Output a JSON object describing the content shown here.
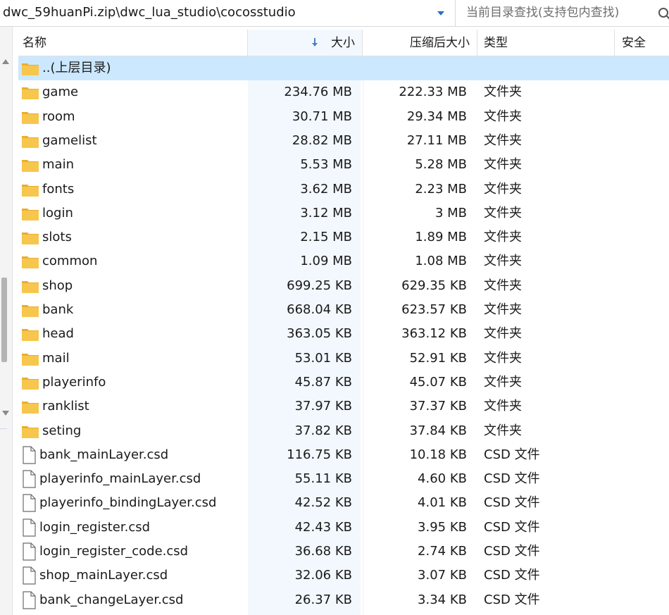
{
  "address": {
    "path": "dwc_59huanPi.zip\\dwc_lua_studio\\cocosstudio",
    "search_placeholder": "当前目录查找(支持包内查找)"
  },
  "columns": {
    "name": "名称",
    "size": "大小",
    "compressed": "压缩后大小",
    "type": "类型",
    "security": "安全"
  },
  "rows": [
    {
      "icon": "folder-icon",
      "name": "..(上层目录)",
      "size": "",
      "compressed": "",
      "type": "",
      "selected": true
    },
    {
      "icon": "folder-icon",
      "name": "game",
      "size": "234.76 MB",
      "compressed": "222.33 MB",
      "type": "文件夹"
    },
    {
      "icon": "folder-icon",
      "name": "room",
      "size": "30.71 MB",
      "compressed": "29.34 MB",
      "type": "文件夹"
    },
    {
      "icon": "folder-icon",
      "name": "gamelist",
      "size": "28.82 MB",
      "compressed": "27.11 MB",
      "type": "文件夹"
    },
    {
      "icon": "folder-icon",
      "name": "main",
      "size": "5.53 MB",
      "compressed": "5.28 MB",
      "type": "文件夹"
    },
    {
      "icon": "folder-icon",
      "name": "fonts",
      "size": "3.62 MB",
      "compressed": "2.23 MB",
      "type": "文件夹"
    },
    {
      "icon": "folder-icon",
      "name": "login",
      "size": "3.12 MB",
      "compressed": "3 MB",
      "type": "文件夹"
    },
    {
      "icon": "folder-icon",
      "name": "slots",
      "size": "2.15 MB",
      "compressed": "1.89 MB",
      "type": "文件夹"
    },
    {
      "icon": "folder-icon",
      "name": "common",
      "size": "1.09 MB",
      "compressed": "1.08 MB",
      "type": "文件夹"
    },
    {
      "icon": "folder-icon",
      "name": "shop",
      "size": "699.25 KB",
      "compressed": "629.35 KB",
      "type": "文件夹"
    },
    {
      "icon": "folder-icon",
      "name": "bank",
      "size": "668.04 KB",
      "compressed": "623.57 KB",
      "type": "文件夹"
    },
    {
      "icon": "folder-icon",
      "name": "head",
      "size": "363.05 KB",
      "compressed": "363.12 KB",
      "type": "文件夹"
    },
    {
      "icon": "folder-icon",
      "name": "mail",
      "size": "53.01 KB",
      "compressed": "52.91 KB",
      "type": "文件夹"
    },
    {
      "icon": "folder-icon",
      "name": "playerinfo",
      "size": "45.87 KB",
      "compressed": "45.07 KB",
      "type": "文件夹"
    },
    {
      "icon": "folder-icon",
      "name": "ranklist",
      "size": "37.97 KB",
      "compressed": "37.37 KB",
      "type": "文件夹"
    },
    {
      "icon": "folder-icon",
      "name": "seting",
      "size": "37.82 KB",
      "compressed": "37.84 KB",
      "type": "文件夹"
    },
    {
      "icon": "file-icon",
      "name": "bank_mainLayer.csd",
      "size": "116.75 KB",
      "compressed": "10.18 KB",
      "type": "CSD 文件"
    },
    {
      "icon": "file-icon",
      "name": "playerinfo_mainLayer.csd",
      "size": "55.11 KB",
      "compressed": "4.60 KB",
      "type": "CSD 文件"
    },
    {
      "icon": "file-icon",
      "name": "playerinfo_bindingLayer.csd",
      "size": "42.52 KB",
      "compressed": "4.01 KB",
      "type": "CSD 文件"
    },
    {
      "icon": "file-icon",
      "name": "login_register.csd",
      "size": "42.43 KB",
      "compressed": "3.95 KB",
      "type": "CSD 文件"
    },
    {
      "icon": "file-icon",
      "name": "login_register_code.csd",
      "size": "36.68 KB",
      "compressed": "2.74 KB",
      "type": "CSD 文件"
    },
    {
      "icon": "file-icon",
      "name": "shop_mainLayer.csd",
      "size": "32.06 KB",
      "compressed": "3.07 KB",
      "type": "CSD 文件"
    },
    {
      "icon": "file-icon",
      "name": "bank_changeLayer.csd",
      "size": "26.37 KB",
      "compressed": "3.34 KB",
      "type": "CSD 文件"
    }
  ],
  "colors": {
    "selected_row": "#cce8ff",
    "sorted_column": "#f2f8fe",
    "folder": "#f5c34b",
    "sort_arrow": "#4a7fc1"
  }
}
